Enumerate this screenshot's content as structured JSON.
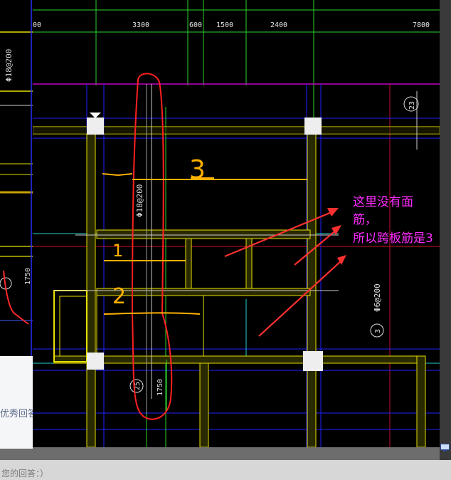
{
  "dimensions": {
    "labels": [
      "00",
      "3300",
      "600",
      "1500",
      "2400",
      "7800"
    ]
  },
  "rebar_labels": {
    "vertical_main": "Φ18@200",
    "left_doc": "Φ18@200",
    "right": "Φ6@200"
  },
  "dim_1750": "1750",
  "left_dim": "1750",
  "grid_bubbles": [
    "23",
    "3",
    "25"
  ],
  "handwritten_numbers": [
    "3",
    "1",
    "2"
  ],
  "annotation": {
    "line1": "这里没有面",
    "line2": "筋，",
    "line3": "所以跨板筋是3"
  },
  "page_ui": {
    "reply_label": "优秀回答",
    "answer_hint": "您的回答：）"
  },
  "colors": {
    "annotation_text": "#ff2cff",
    "arrows": "#ff3030",
    "circle": "#ff2020",
    "handwriting": "#ffb000",
    "walls": "#e8e000"
  },
  "icons": {
    "monitor": "monitor-icon"
  }
}
